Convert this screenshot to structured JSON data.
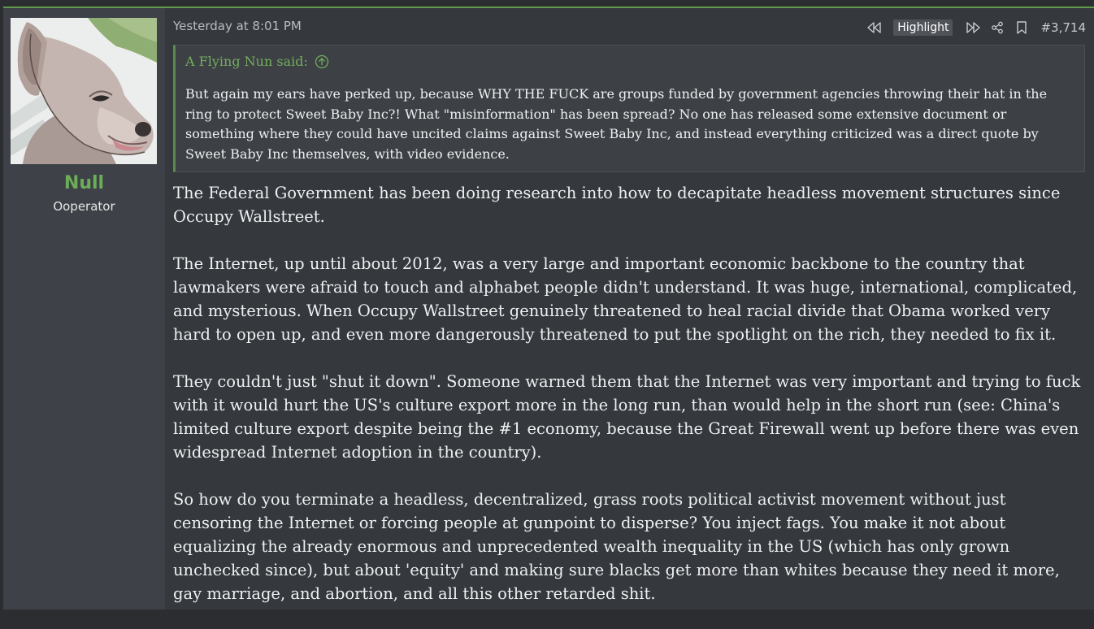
{
  "post": {
    "timestamp": "Yesterday at 8:01 PM",
    "highlight_label": "Highlight",
    "post_number": "#3,714",
    "icons": {
      "prev": "rewind-icon",
      "next": "fast-forward-icon",
      "share": "share-icon",
      "bookmark": "bookmark-icon",
      "jump_to_quote": "arrow-up-circle-icon"
    }
  },
  "user": {
    "name": "Null",
    "title": "Ooperator",
    "avatar": "dog-avatar",
    "name_color": "#6cad58"
  },
  "quote": {
    "author_line": "A Flying Nun said:",
    "text": "But again my ears have perked up, because WHY THE FUCK are groups funded by government agencies throwing their hat in the ring to protect Sweet Baby Inc?! What \"misinformation\" has been spread? No one has released some extensive document or something where they could have uncited claims against Sweet Baby Inc, and instead everything criticized was a direct quote by Sweet Baby Inc themselves, with video evidence."
  },
  "body": {
    "paragraphs": [
      "The Federal Government has been doing research into how to decapitate headless movement structures since Occupy Wallstreet.",
      "The Internet, up until about 2012, was a very large and important economic backbone to the country that lawmakers were afraid to touch and alphabet people didn't understand. It was huge, international, complicated, and mysterious. When Occupy Wallstreet genuinely threatened to heal racial divide that Obama worked very hard to open up, and even more dangerously threatened to put the spotlight on the rich, they needed to fix it.",
      "They couldn't just \"shut it down\". Someone warned them that the Internet was very important and trying to fuck with it would hurt the US's culture export more in the long run, than would help in the short run (see: China's limited culture export despite being the #1 economy, because the Great Firewall went up before there was even widespread Internet adoption in the country).",
      "So how do you terminate a headless, decentralized, grass roots political activist movement without just censoring the Internet or forcing people at gunpoint to disperse? You inject fags. You make it not about equalizing the already enormous and unprecedented wealth inequality in the US (which has only grown unchecked since), but about 'equity' and making sure blacks get more than whites because they need it more, gay marriage, and abortion, and all this other retarded shit."
    ]
  },
  "colors": {
    "accent": "#5f9a4c",
    "background": "#35383d",
    "sidebar": "#3e4147",
    "quote_bg": "#3d4045"
  }
}
